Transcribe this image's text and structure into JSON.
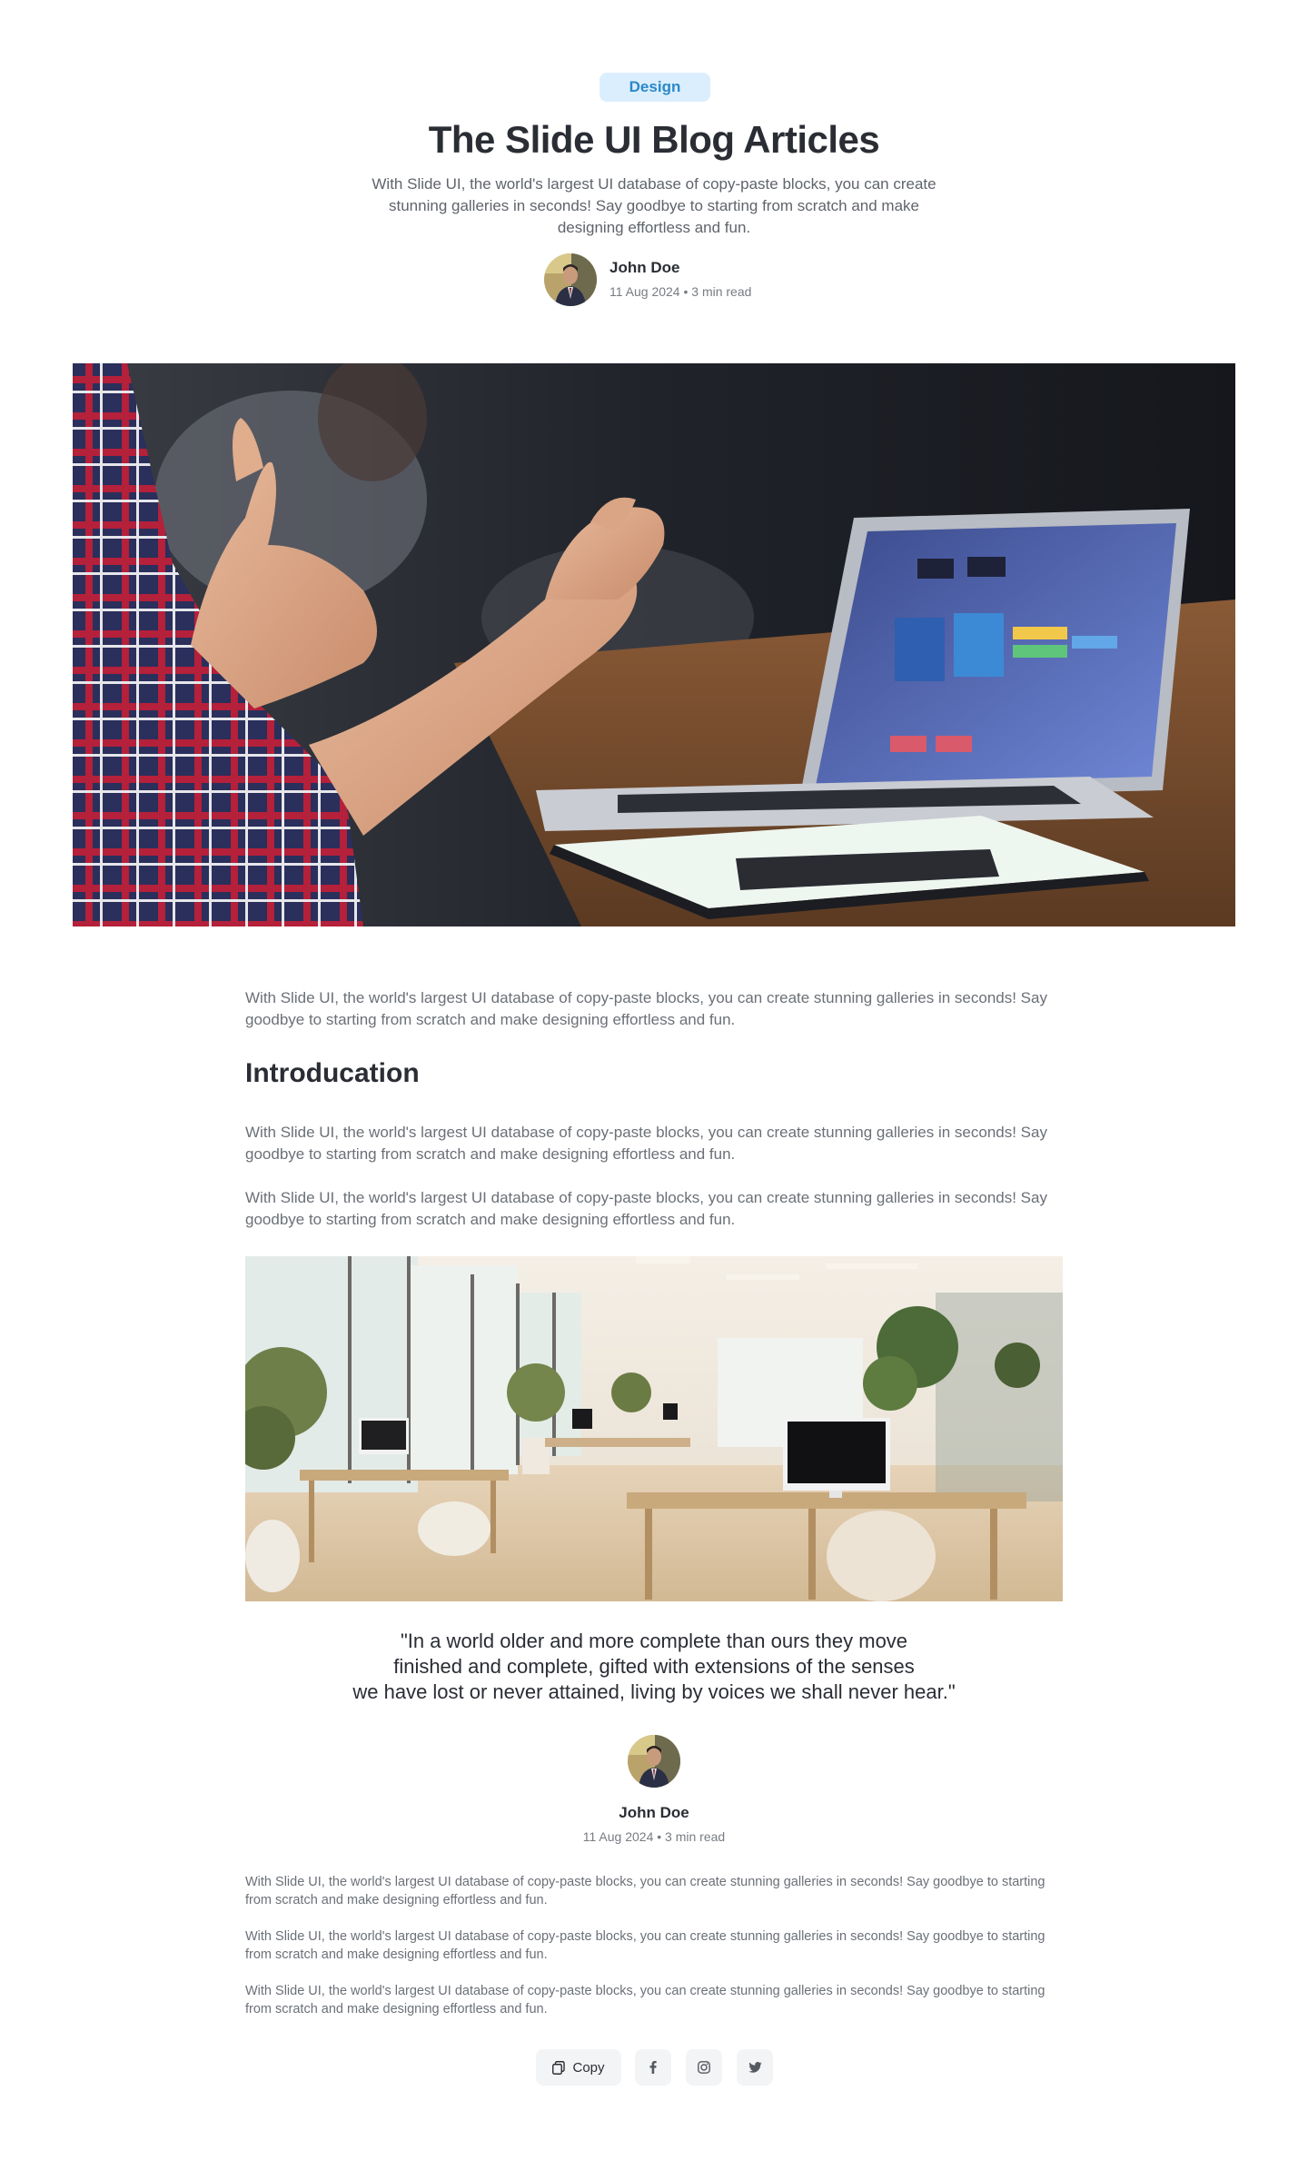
{
  "header": {
    "badge": "Design",
    "title": "The Slide UI Blog Articles",
    "subtitle": "With Slide UI, the world's largest UI database of copy-paste blocks, you can create stunning galleries in seconds! Say goodbye to starting from scratch and make designing effortless and fun."
  },
  "author": {
    "name": "John Doe",
    "meta": "11 Aug 2024 • 3 min read"
  },
  "article": {
    "intro_paragraph": "With Slide UI, the world's largest UI database of copy-paste blocks, you can create stunning galleries in seconds! Say goodbye to starting from scratch and make designing effortless and fun.",
    "section_heading": "Introducation",
    "paragraph_1": "With Slide UI, the world's largest UI database of copy-paste blocks, you can create stunning galleries in seconds! Say goodbye to starting from scratch and make designing effortless and fun.",
    "paragraph_2": "With Slide UI, the world's largest UI database of copy-paste blocks, you can create stunning galleries in seconds! Say goodbye to starting from scratch and make designing effortless and fun.",
    "quote_line_1": "\"In a world older and more complete than ours they move",
    "quote_line_2": "finished and complete, gifted with extensions of the senses",
    "quote_line_3": "we have lost or never attained, living by voices we shall never hear.\"",
    "footer_paragraphs": [
      "With Slide UI, the world's largest UI database of copy-paste blocks, you can create stunning galleries in seconds! Say goodbye to starting from scratch and make designing effortless and fun.",
      "With Slide UI, the world's largest UI database of copy-paste blocks, you can create stunning galleries in seconds! Say goodbye to starting from scratch and make designing effortless and fun.",
      "With Slide UI, the world's largest UI database of copy-paste blocks, you can create stunning galleries in seconds! Say goodbye to starting from scratch and make designing effortless and fun."
    ]
  },
  "share": {
    "copy_label": "Copy",
    "icons": [
      "copy-icon",
      "facebook-icon",
      "instagram-icon",
      "twitter-icon"
    ]
  },
  "colors": {
    "badge_bg": "#dbeefe",
    "badge_text": "#2b88c9",
    "heading": "#2a2d34",
    "body_text": "#6b7077"
  }
}
